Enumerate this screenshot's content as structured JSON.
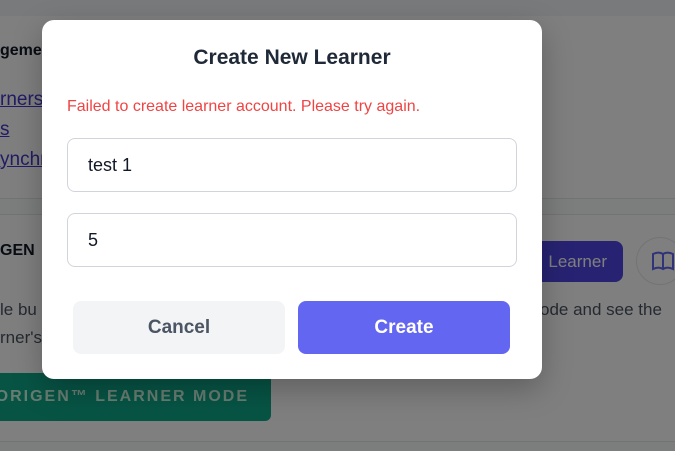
{
  "background": {
    "management_heading": "gemen",
    "links": [
      "rners",
      "s",
      "ynchr"
    ],
    "origen_title": "GEN",
    "learner_button_label": "Learner",
    "book_icon": "book-open-icon",
    "description_line1_left": "le bu",
    "description_line1_right": "ode and see the",
    "description_line2_left": "rner's",
    "mode_button_label": "ORIGEN™ LEARNER MODE"
  },
  "modal": {
    "title": "Create New Learner",
    "error_message": "Failed to create learner account. Please try again.",
    "name_value": "test 1",
    "age_value": "5",
    "cancel_label": "Cancel",
    "create_label": "Create"
  },
  "colors": {
    "primary": "#6366f1",
    "error": "#ef4444",
    "teal": "#0fa88a"
  }
}
